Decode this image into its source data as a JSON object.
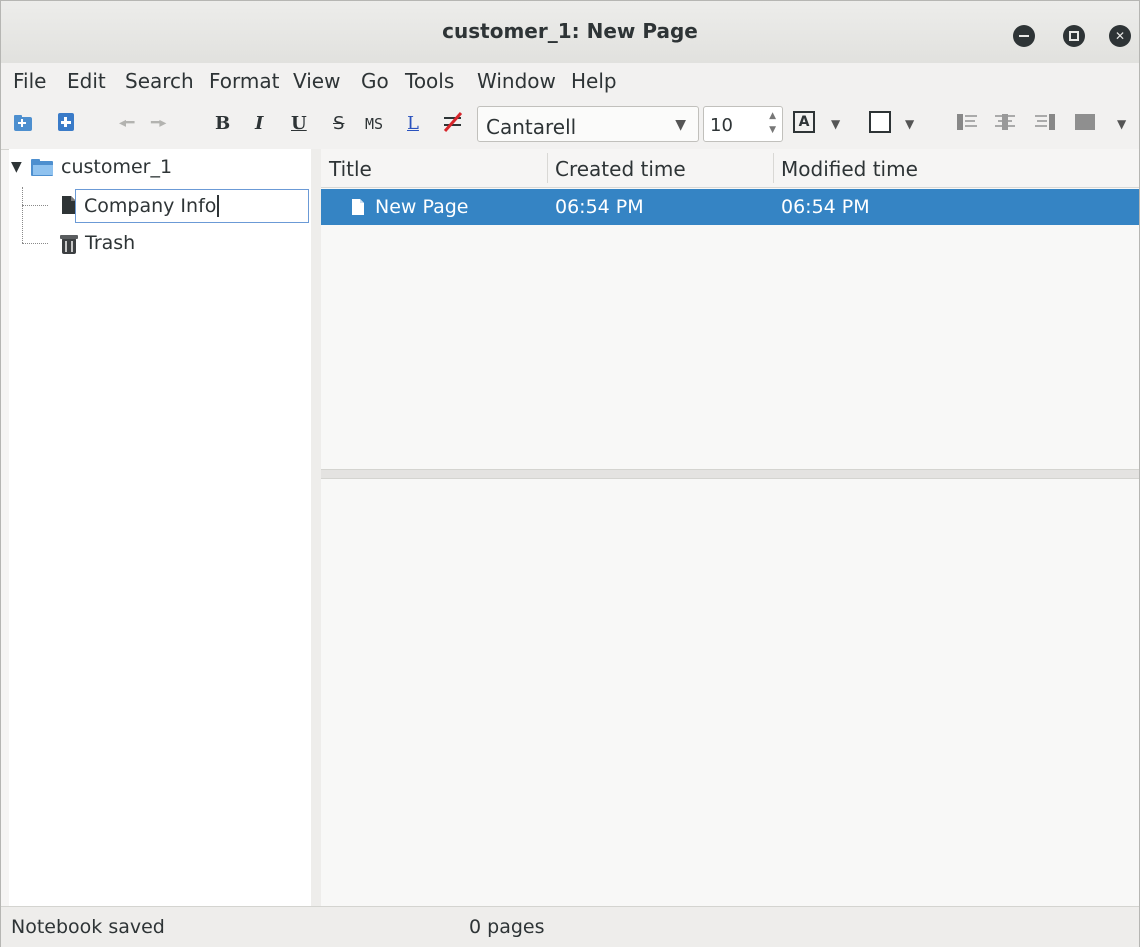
{
  "window": {
    "title": "customer_1: New Page"
  },
  "menu": [
    "File",
    "Edit",
    "Search",
    "Format",
    "View",
    "Go",
    "Tools",
    "Window",
    "Help"
  ],
  "toolbar": {
    "bold": "B",
    "italic": "I",
    "underline": "U",
    "strike": "S",
    "monospace": "MS",
    "link": "L",
    "font_family": "Cantarell",
    "font_size": "10",
    "text_color_glyph": "A"
  },
  "tree": {
    "notebook": "customer_1",
    "pages": [
      {
        "label": "Company Info",
        "editing": true
      },
      {
        "label": "Trash",
        "icon": "trash-icon"
      }
    ]
  },
  "list": {
    "columns": [
      "Title",
      "Created time",
      "Modified time"
    ],
    "rows": [
      {
        "title": "New Page",
        "created": "06:54 PM",
        "modified": "06:54 PM",
        "selected": true
      }
    ]
  },
  "status": {
    "left": "Notebook saved",
    "center": "0 pages"
  },
  "colors": {
    "selection": "#3584c4",
    "focus_border": "#6b9ad6"
  }
}
